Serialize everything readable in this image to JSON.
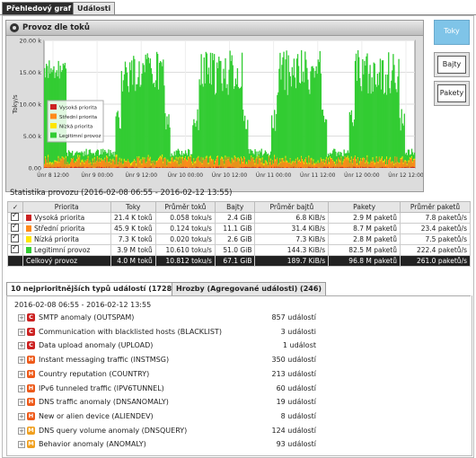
{
  "top_tabs": [
    "Přehledový graf",
    "Události"
  ],
  "graph": {
    "title": "Provoz dle toků",
    "ylabel": "Toky/s",
    "yticks": [
      "0.00",
      "5.00 k",
      "10.00 k",
      "15.00 k",
      "20.00 k"
    ],
    "xticks": [
      "Únr 8 12:00",
      "Únr 9 00:00",
      "Únr 9 12:00",
      "Únr 10 00:00",
      "Únr 10 12:00",
      "Únr 11 00:00",
      "Únr 11 12:00",
      "Únr 12 00:00",
      "Únr 12 12:00"
    ],
    "legend": [
      "Vysoká priorita",
      "Střední priorita",
      "Nízká priorita",
      "Legitimní provoz"
    ]
  },
  "chart_data": {
    "type": "area",
    "ylabel": "Toky/s",
    "ylim": [
      0,
      20000
    ],
    "series": [
      {
        "name": "Vysoká priorita",
        "color": "#cc2222",
        "peak": 100
      },
      {
        "name": "Střední priorita",
        "color": "#ff8a1a",
        "peak": 800
      },
      {
        "name": "Nízká priorita",
        "color": "#ffe600",
        "peak": 400
      },
      {
        "name": "Legitimní provoz",
        "color": "#33cc33",
        "peak": 14500
      }
    ],
    "x": [
      "Únr 8 12:00",
      "Únr 9 00:00",
      "Únr 9 12:00",
      "Únr 10 00:00",
      "Únr 10 12:00",
      "Únr 11 00:00",
      "Únr 11 12:00",
      "Únr 12 00:00",
      "Únr 12 12:00"
    ]
  },
  "side_buttons": [
    "Toky",
    "Bajty",
    "Pakety"
  ],
  "stats": {
    "title": "Statistika provozu (2016-02-08 06:55 - 2016-02-12 13:55)",
    "headers": [
      "✓",
      "Priorita",
      "Toky",
      "Průměr toků",
      "Bajty",
      "Průměr bajtů",
      "Pakety",
      "Průměr paketů"
    ],
    "rows": [
      {
        "label": "Vysoká priorita",
        "color": "#cc2222",
        "toky": "21.4 K toků",
        "prumer_toku": "0.058 toku/s",
        "bajty": "2.4 GiB",
        "prumer_bajtu": "6.8 KiB/s",
        "pakety": "2.9 M paketů",
        "prumer_paketu": "7.8 paketů/s"
      },
      {
        "label": "Střední priorita",
        "color": "#ff8a1a",
        "toky": "45.9 K toků",
        "prumer_toku": "0.124 toku/s",
        "bajty": "11.1 GiB",
        "prumer_bajtu": "31.4 KiB/s",
        "pakety": "8.7 M paketů",
        "prumer_paketu": "23.4 paketů/s"
      },
      {
        "label": "Nízká priorita",
        "color": "#ffe600",
        "toky": "7.3 K toků",
        "prumer_toku": "0.020 toku/s",
        "bajty": "2.6 GiB",
        "prumer_bajtu": "7.3 KiB/s",
        "pakety": "2.8 M paketů",
        "prumer_paketu": "7.5 paketů/s"
      },
      {
        "label": "Legitimní provoz",
        "color": "#33cc33",
        "toky": "3.9 M toků",
        "prumer_toku": "10.610 toku/s",
        "bajty": "51.0 GiB",
        "prumer_bajtu": "144.3 KiB/s",
        "pakety": "82.5 M paketů",
        "prumer_paketu": "222.4 paketů/s"
      }
    ],
    "total": {
      "label": "Celkový provoz",
      "toky": "4.0 M toků",
      "prumer_toku": "10.812 toku/s",
      "bajty": "67.1 GiB",
      "prumer_bajtu": "189.7 KiB/s",
      "pakety": "96.8 M paketů",
      "prumer_paketu": "261.0 paketů/s"
    }
  },
  "event_tabs": [
    "10 nejprioritnějších typů událostí (1728)",
    "Hrozby (Agregované události) (246)"
  ],
  "events_date": "2016-02-08 06:55 - 2016-02-12 13:55",
  "events": [
    {
      "badge": "C",
      "color": "#cc2222",
      "name": "SMTP anomaly (OUTSPAM)",
      "count": "857 událostí"
    },
    {
      "badge": "C",
      "color": "#cc2222",
      "name": "Communication with blacklisted hosts (BLACKLIST)",
      "count": "3 události"
    },
    {
      "badge": "C",
      "color": "#cc2222",
      "name": "Data upload anomaly (UPLOAD)",
      "count": "1 událost"
    },
    {
      "badge": "H",
      "color": "#ee5a1a",
      "name": "Instant messaging traffic (INSTMSG)",
      "count": "350 událostí"
    },
    {
      "badge": "H",
      "color": "#ee5a1a",
      "name": "Country reputation (COUNTRY)",
      "count": "213 událostí"
    },
    {
      "badge": "H",
      "color": "#ee5a1a",
      "name": "IPv6 tunneled traffic (IPV6TUNNEL)",
      "count": "60 událostí"
    },
    {
      "badge": "H",
      "color": "#ee5a1a",
      "name": "DNS traffic anomaly (DNSANOMALY)",
      "count": "19 událostí"
    },
    {
      "badge": "H",
      "color": "#ee5a1a",
      "name": "New or alien device (ALIENDEV)",
      "count": "8 událostí"
    },
    {
      "badge": "M",
      "color": "#f0a020",
      "name": "DNS query volume anomaly (DNSQUERY)",
      "count": "124 událostí"
    },
    {
      "badge": "M",
      "color": "#f0a020",
      "name": "Behavior anomaly (ANOMALY)",
      "count": "93 událostí"
    }
  ]
}
